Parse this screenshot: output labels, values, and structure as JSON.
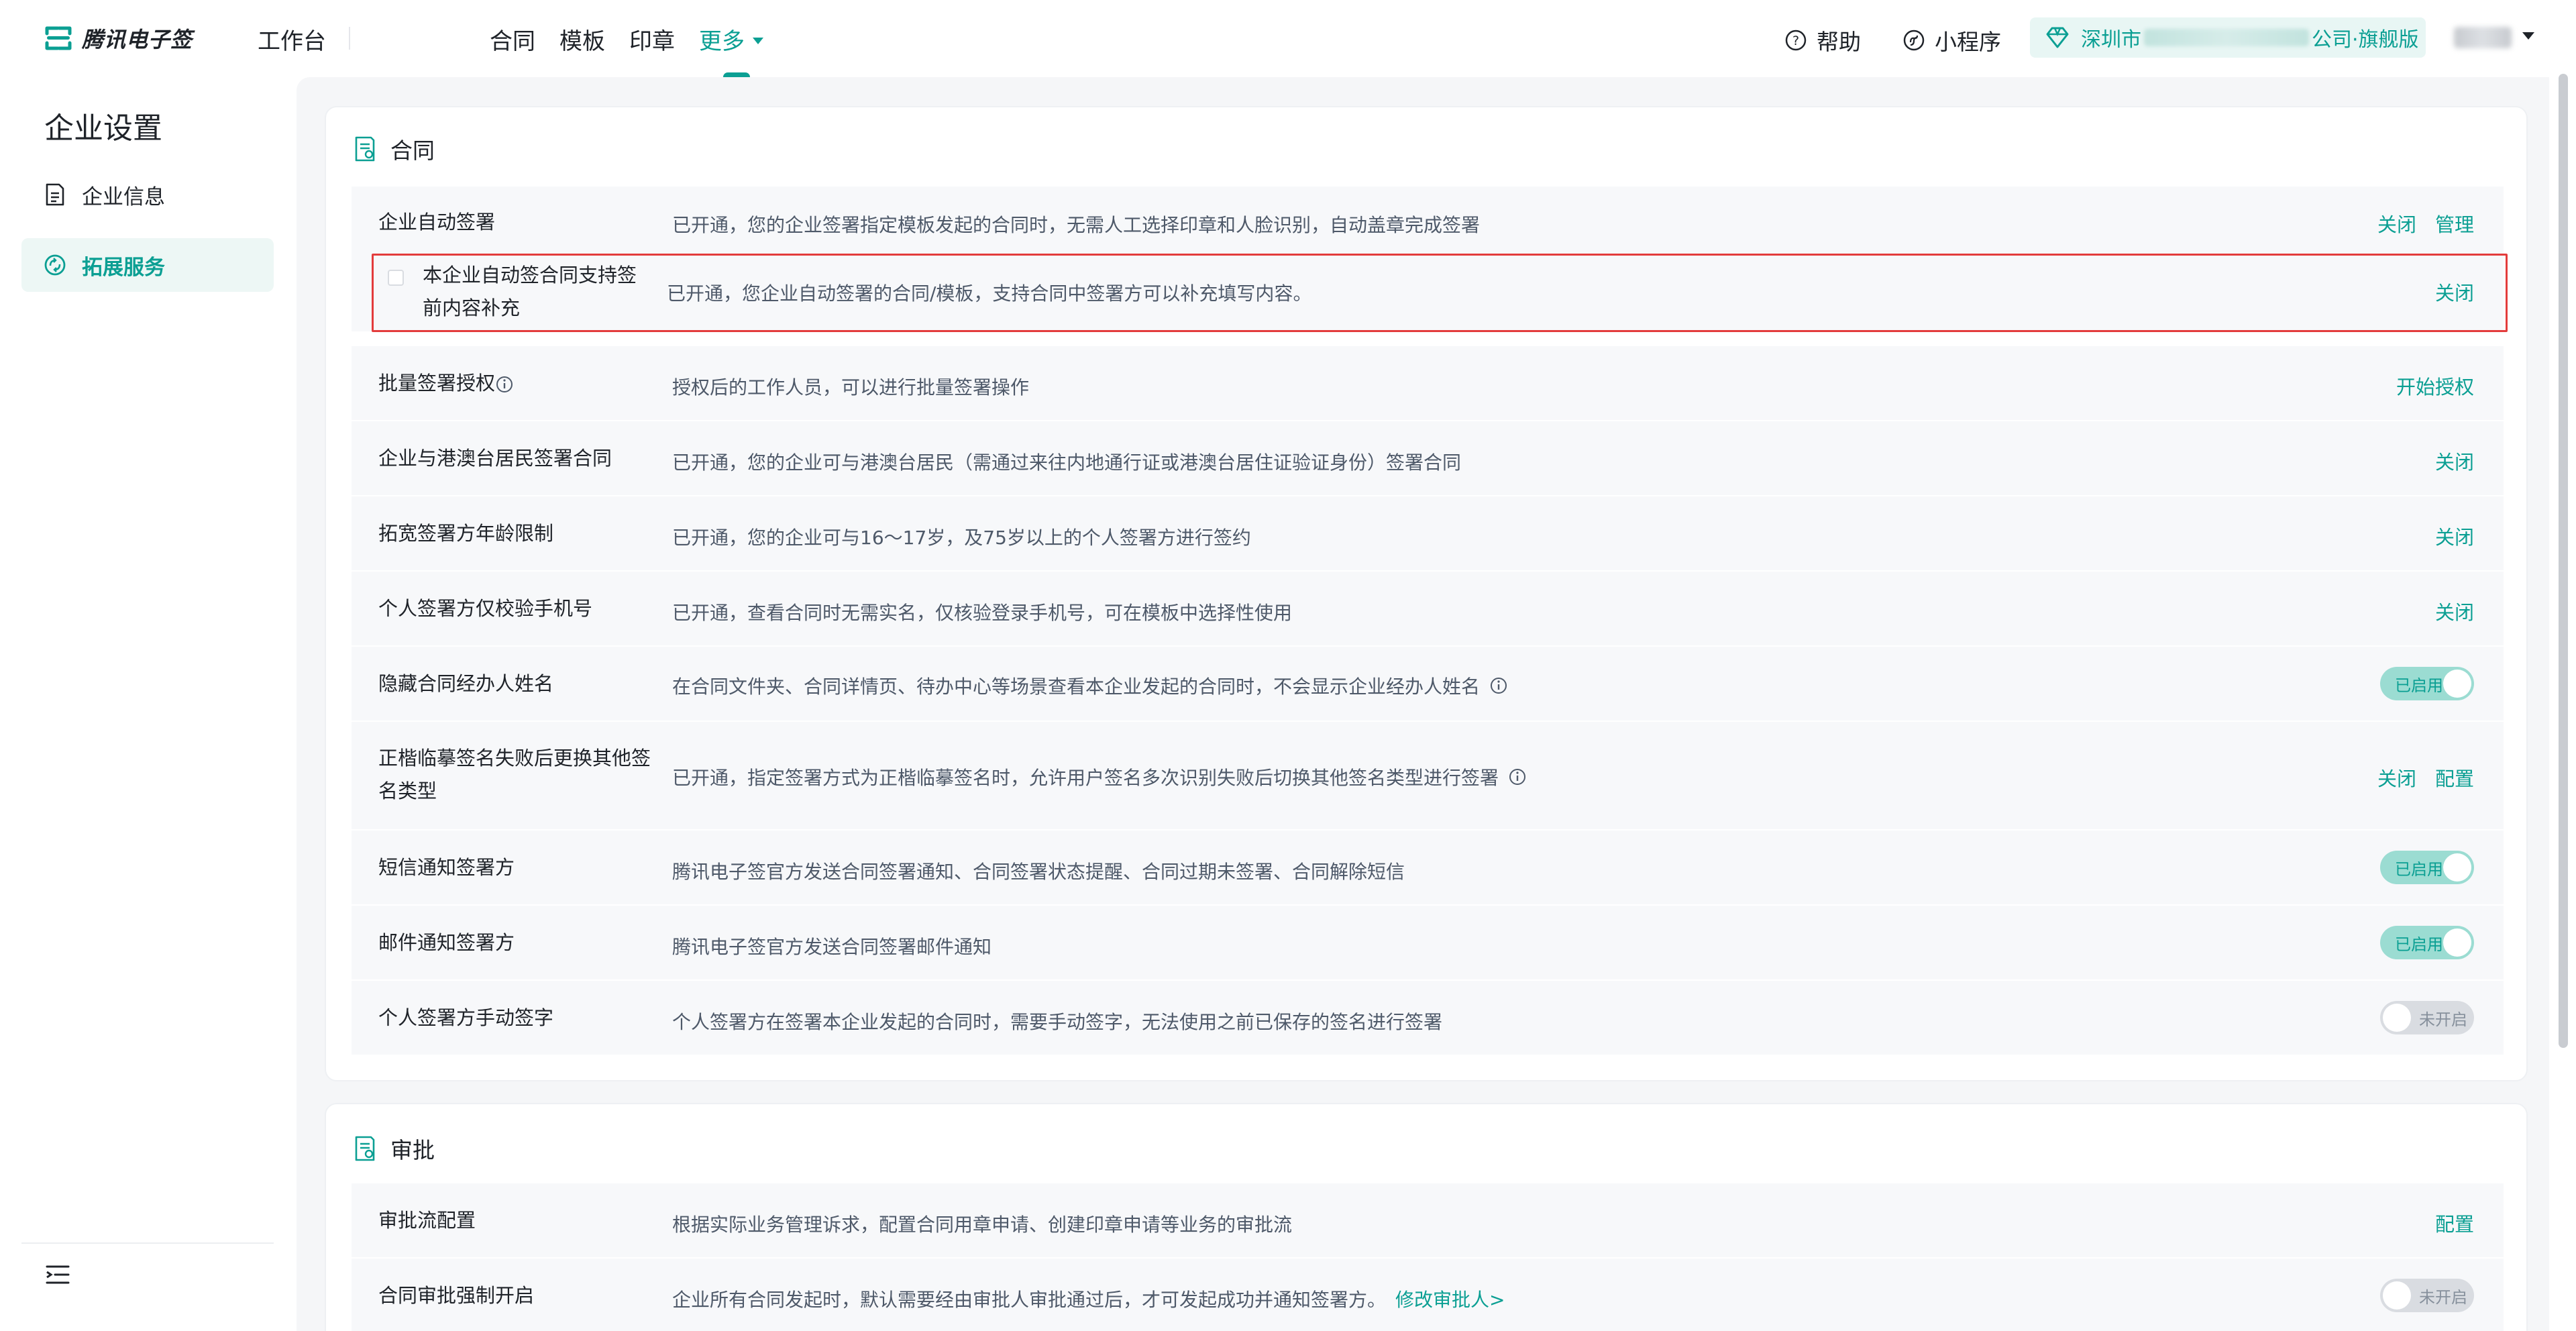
{
  "header": {
    "logo_text": "腾讯电子签",
    "workbench": "工作台",
    "nav": [
      "合同",
      "模板",
      "印章",
      "更多"
    ],
    "help": "帮助",
    "mini_program": "小程序",
    "company_prefix": "深圳市",
    "company_suffix": "公司·旗舰版",
    "accent_color": "#0b9f93"
  },
  "sidebar": {
    "title": "企业设置",
    "items": [
      {
        "label": "企业信息",
        "icon": "document-icon"
      },
      {
        "label": "拓展服务",
        "icon": "service-icon"
      }
    ]
  },
  "contract": {
    "title": "合同",
    "rows": [
      {
        "name": "企业自动签署",
        "desc": "已开通，您的企业签署指定模板发起的合同时，无需人工选择印章和人脸识别，自动盖章完成签署",
        "actions": [
          "关闭",
          "管理"
        ]
      },
      {
        "name": "本企业自动签合同支持签前内容补充",
        "desc": "已开通，您企业自动签署的合同/模板，支持合同中签署方可以补充填写内容。",
        "actions": [
          "关闭"
        ]
      },
      {
        "name": "批量签署授权",
        "desc": "授权后的工作人员，可以进行批量签署操作",
        "actions": [
          "开始授权"
        ]
      },
      {
        "name": "企业与港澳台居民签署合同",
        "desc": "已开通，您的企业可与港澳台居民（需通过来往内地通行证或港澳台居住证验证身份）签署合同",
        "actions": [
          "关闭"
        ]
      },
      {
        "name": "拓宽签署方年龄限制",
        "desc": "已开通，您的企业可与16～17岁，及75岁以上的个人签署方进行签约",
        "actions": [
          "关闭"
        ]
      },
      {
        "name": "个人签署方仅校验手机号",
        "desc": "已开通，查看合同时无需实名，仅核验登录手机号，可在模板中选择性使用",
        "actions": [
          "关闭"
        ]
      },
      {
        "name": "隐藏合同经办人姓名",
        "desc": "在合同文件夹、合同详情页、待办中心等场景查看本企业发起的合同时，不会显示企业经办人姓名",
        "toggle": "已启用"
      },
      {
        "name": "正楷临摹签名失败后更换其他签名类型",
        "desc": "已开通，指定签署方式为正楷临摹签名时，允许用户签名多次识别失败后切换其他签名类型进行签署",
        "actions": [
          "关闭",
          "配置"
        ]
      },
      {
        "name": "短信通知签署方",
        "desc": "腾讯电子签官方发送合同签署通知、合同签署状态提醒、合同过期未签署、合同解除短信",
        "toggle": "已启用"
      },
      {
        "name": "邮件通知签署方",
        "desc": "腾讯电子签官方发送合同签署邮件通知",
        "toggle": "已启用"
      },
      {
        "name": "个人签署方手动签字",
        "desc": "个人签署方在签署本企业发起的合同时，需要手动签字，无法使用之前已保存的签名进行签署",
        "toggle": "未开启"
      }
    ]
  },
  "approval": {
    "title": "审批",
    "rows": [
      {
        "name": "审批流配置",
        "desc": "根据实际业务管理诉求，配置合同用章申请、创建印章申请等业务的审批流",
        "actions": [
          "配置"
        ]
      },
      {
        "name": "合同审批强制开启",
        "desc": "企业所有合同发起时，默认需要经由审批人审批通过后，才可发起成功并通知签署方。",
        "link": "修改审批人>",
        "toggle": "未开启"
      }
    ]
  }
}
